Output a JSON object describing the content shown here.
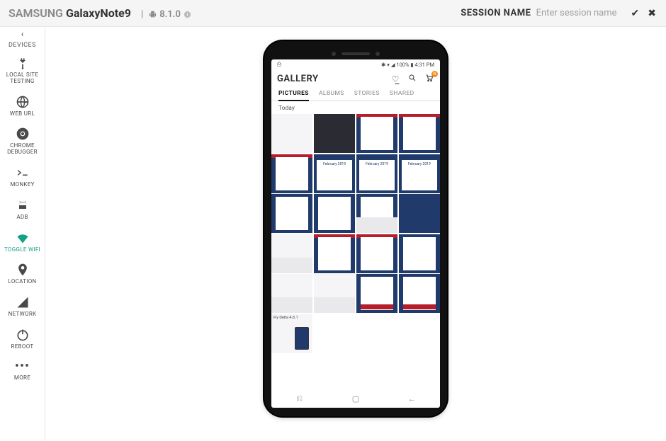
{
  "topbar": {
    "brand": "SAMSUNG",
    "model": "GalaxyNote9",
    "os_version": "8.1.0",
    "session_label": "SESSION NAME",
    "session_placeholder": "Enter session name"
  },
  "sidebar": {
    "back_label": "DEVICES",
    "items": [
      {
        "id": "local",
        "label": "LOCAL SITE\nTESTING"
      },
      {
        "id": "weburl",
        "label": "WEB URL"
      },
      {
        "id": "debugger",
        "label": "CHROME\nDEBUGGER"
      },
      {
        "id": "monkey",
        "label": "MONKEY"
      },
      {
        "id": "adb",
        "label": "ADB"
      },
      {
        "id": "wifi",
        "label": "TOGGLE WIFI",
        "active": true
      },
      {
        "id": "location",
        "label": "LOCATION"
      },
      {
        "id": "network",
        "label": "NETWORK"
      },
      {
        "id": "reboot",
        "label": "REBOOT"
      },
      {
        "id": "more",
        "label": "MORE"
      }
    ]
  },
  "phone": {
    "status": {
      "icons": "✱ ▾ ◢ 100% ▮",
      "time": "4:31 PM"
    },
    "gallery": {
      "title": "GALLERY",
      "cart_badge": "N",
      "tabs": [
        "PICTURES",
        "ALBUMS",
        "STORIES",
        "SHARED"
      ],
      "active_tab": 0,
      "section": "Today",
      "grid": [
        {
          "kind": "lite"
        },
        {
          "kind": "dark"
        },
        {
          "kind": "redtop-card"
        },
        {
          "kind": "redtop-card"
        },
        {
          "kind": "redtop"
        },
        {
          "kind": "calendar",
          "label": "February 2019"
        },
        {
          "kind": "calendar",
          "label": "February 2019"
        },
        {
          "kind": "calendar",
          "label": "February 2019"
        },
        {
          "kind": "card"
        },
        {
          "kind": "card"
        },
        {
          "kind": "card-kbd"
        },
        {
          "kind": "solid"
        },
        {
          "kind": "kbd"
        },
        {
          "kind": "redtop-card"
        },
        {
          "kind": "redtop-card"
        },
        {
          "kind": "card"
        },
        {
          "kind": "kbd"
        },
        {
          "kind": "kbd"
        },
        {
          "kind": "card-redbtn"
        },
        {
          "kind": "card-redbtn"
        },
        {
          "kind": "lite-mini",
          "label": "Fly Delta 4.8.1"
        }
      ],
      "navbar": [
        "recent",
        "home",
        "back"
      ]
    }
  }
}
